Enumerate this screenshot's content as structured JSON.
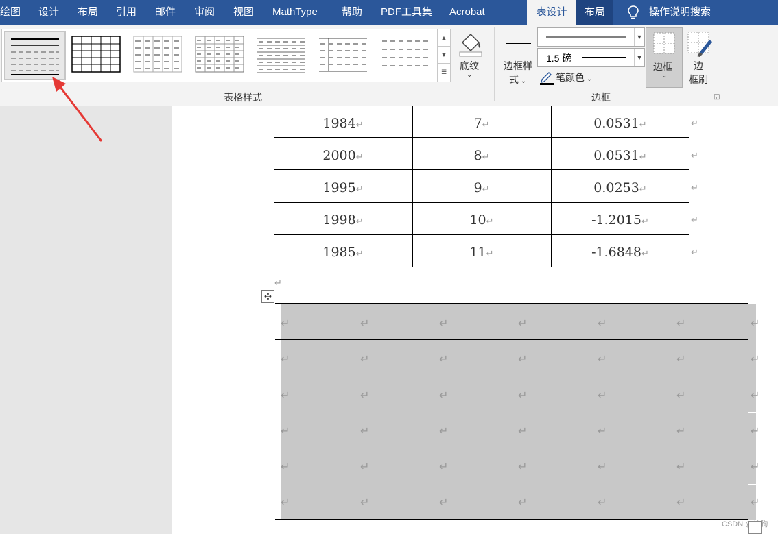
{
  "tabs": [
    {
      "label": "绘图"
    },
    {
      "label": "设计"
    },
    {
      "label": "布局"
    },
    {
      "label": "引用"
    },
    {
      "label": "邮件"
    },
    {
      "label": "审阅"
    },
    {
      "label": "视图"
    },
    {
      "label": "MathType"
    },
    {
      "label": "帮助"
    },
    {
      "label": "PDF工具集"
    },
    {
      "label": "Acrobat"
    },
    {
      "label": "表设计"
    },
    {
      "label": "布局"
    },
    {
      "label": "操作说明搜索"
    }
  ],
  "ribbon": {
    "table_styles_group": "表格样式",
    "shading": "底纹",
    "border_styles_line1": "边框样",
    "border_styles_line2": "式",
    "pen_weight": "1.5 磅",
    "pen_color": "笔颜色",
    "borders_button": "边框",
    "border_painter_line1": "边",
    "border_painter_line2": "框刷",
    "borders_group": "边框"
  },
  "table1": {
    "rows": [
      [
        "1984",
        "7",
        "0.0531"
      ],
      [
        "2000",
        "8",
        "0.0531"
      ],
      [
        "1995",
        "9",
        "0.0253"
      ],
      [
        "1998",
        "10",
        "-1.2015"
      ],
      [
        "1985",
        "11",
        "-1.6848"
      ]
    ]
  },
  "marks": {
    "paragraph": "↵",
    "move": "✣"
  },
  "watermark": "CSDN @效狗"
}
